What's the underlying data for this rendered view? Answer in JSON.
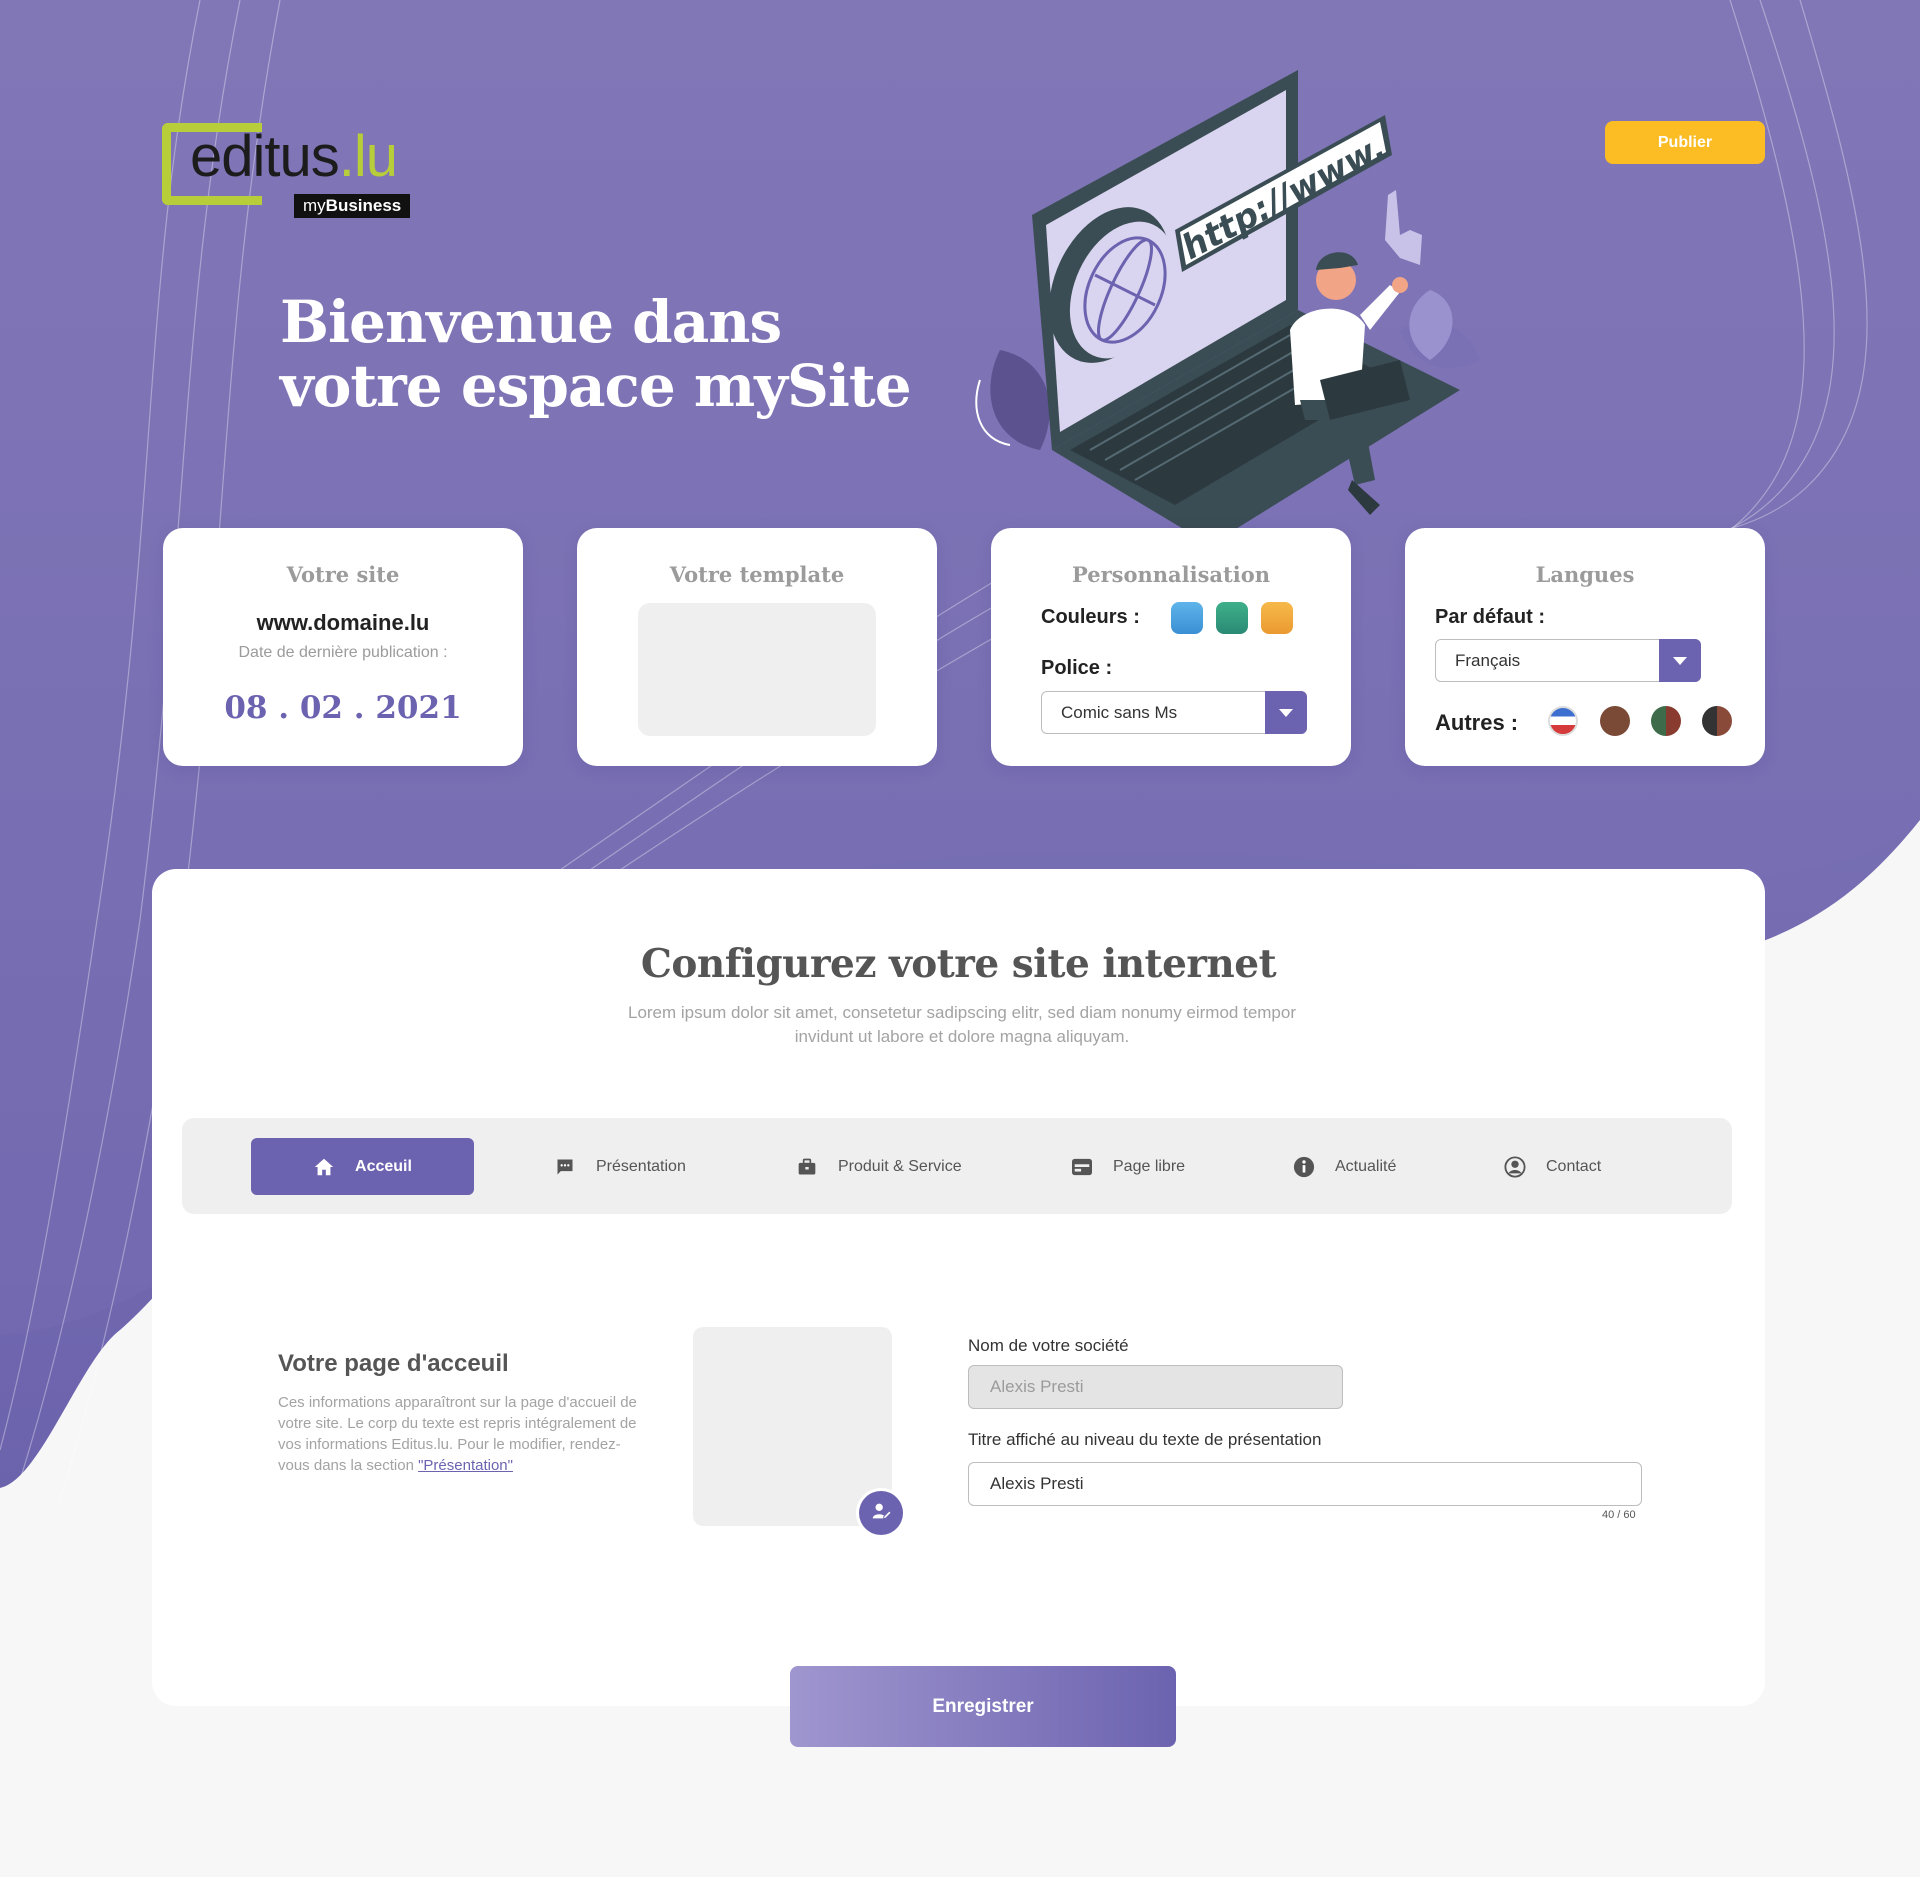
{
  "brand": {
    "logo_main": "editus",
    "logo_accent": ".lu",
    "logo_sub_prefix": "my",
    "logo_sub_bold": "Business"
  },
  "header": {
    "publish_label": "Publier"
  },
  "hero": {
    "title": "Bienvenue dans\nvotre  espace mySite",
    "illustration_text": "http://www."
  },
  "cards": {
    "site": {
      "title": "Votre site",
      "url": "www.domaine.lu",
      "date_label": "Date de dernière publication :",
      "date": "08 . 02 . 2021"
    },
    "template": {
      "title": "Votre template"
    },
    "custom": {
      "title": "Personnalisation",
      "colors_label": "Couleurs :",
      "colors": [
        "#4aa2df",
        "#2f9a7e",
        "#f0a63c"
      ],
      "font_label": "Police :",
      "font_value": "Comic sans Ms"
    },
    "langs": {
      "title": "Langues",
      "default_label": "Par défaut :",
      "default_value": "Français",
      "others_label": "Autres :"
    }
  },
  "main": {
    "title": "Configurez votre site internet",
    "subtitle": "Lorem ipsum dolor sit amet, consetetur sadipscing elitr, sed diam nonumy eirmod tempor invidunt ut labore et dolore magna aliquyam.",
    "tabs": [
      {
        "label": "Acceuil",
        "icon": "home-icon"
      },
      {
        "label": "Présentation",
        "icon": "message-icon"
      },
      {
        "label": "Produit & Service",
        "icon": "briefcase-icon"
      },
      {
        "label": "Page libre",
        "icon": "page-icon"
      },
      {
        "label": "Actualité",
        "icon": "info-icon"
      },
      {
        "label": "Contact",
        "icon": "contact-icon"
      }
    ],
    "home": {
      "title": "Votre page d'acceuil",
      "desc": "Ces informations apparaîtront sur la page d'accueil de votre site. Le corp du texte est repris intégralement de vos informations Editus.lu. Pour le modifier, rendez-vous dans la section ",
      "link": "\"Présentation\""
    },
    "form": {
      "company_label": "Nom de votre société",
      "company_value": "Alexis Presti",
      "title_label": "Titre affiché au niveau du texte de présentation",
      "title_value": "Alexis Presti",
      "counter": "40 / 60"
    },
    "save_label": "Enregistrer"
  },
  "colors": {
    "primary": "#6c63b0",
    "accent": "#fbbc24",
    "logo_green": "#b7cd3a"
  }
}
